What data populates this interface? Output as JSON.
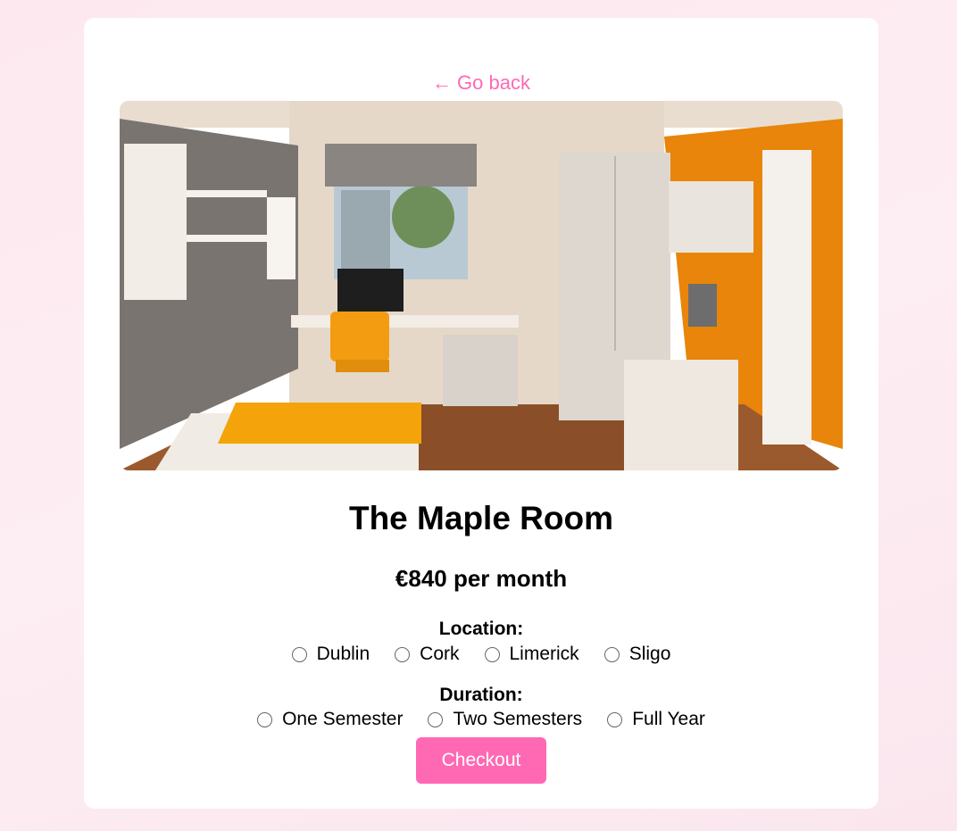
{
  "nav": {
    "back_label": "Go back",
    "back_arrow": "←"
  },
  "room": {
    "image_alt": "Student room with desk, orange chair, wardrobe and bed",
    "title": "The Maple Room",
    "price": "€840 per month"
  },
  "location": {
    "label": "Location:",
    "options": [
      "Dublin",
      "Cork",
      "Limerick",
      "Sligo"
    ],
    "selected": null
  },
  "duration": {
    "label": "Duration:",
    "options": [
      "One Semester",
      "Two Semesters",
      "Full Year"
    ],
    "selected": null
  },
  "actions": {
    "checkout_label": "Checkout"
  },
  "colors": {
    "accent": "#ff69b4",
    "background": "#fde8ef",
    "card": "#ffffff"
  }
}
